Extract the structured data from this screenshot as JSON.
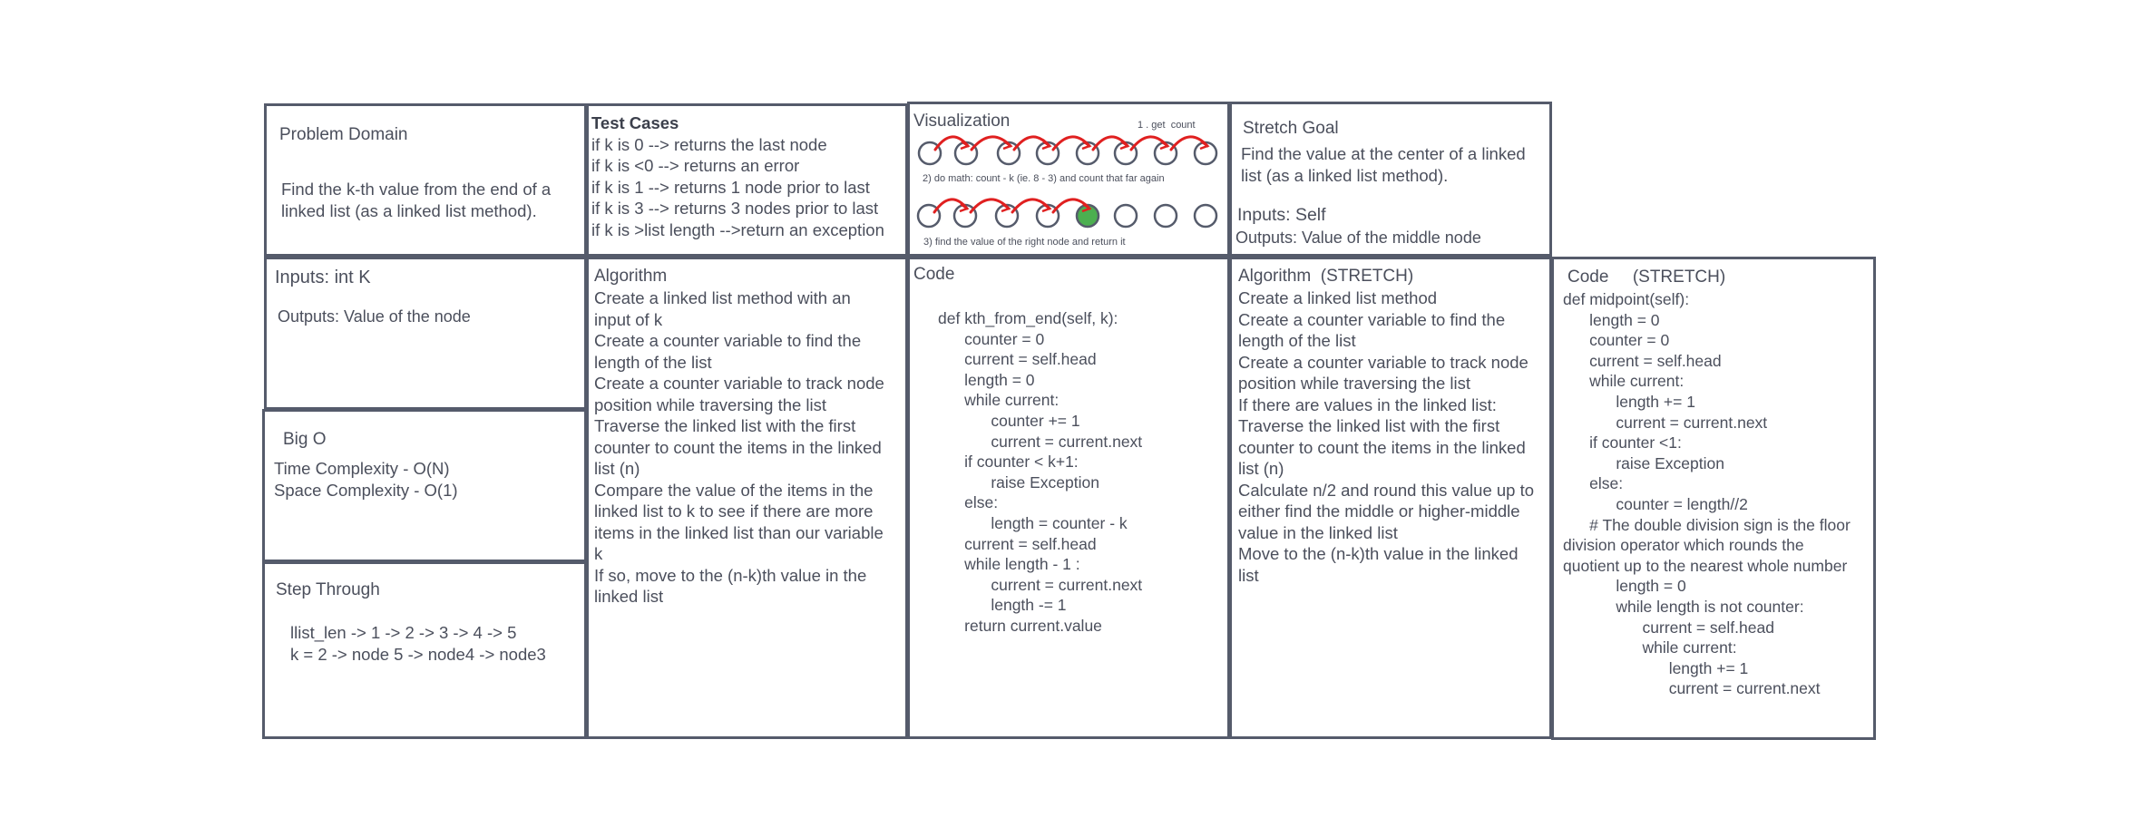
{
  "problem_domain": {
    "title": "Problem Domain",
    "lines": [
      "Find the k-th value from the end of a",
      "linked list (as a linked list method)."
    ]
  },
  "test_cases": {
    "title": "Test Cases",
    "lines": [
      "if k is 0 --> returns the last node",
      "if k is <0 --> returns an error",
      "if k is 1 --> returns 1 node prior to last",
      "if k is 3 --> returns 3 nodes prior to last",
      "if k is >list length -->return an exception"
    ]
  },
  "visualization": {
    "title": "Visualization",
    "step1": "1 . get  count",
    "step2": "2) do math: count - k (ie. 8 - 3) and count that far again",
    "step3": "3) find the value of the right node and return it",
    "row1_nodes": 8,
    "row2_nodes": 8,
    "highlight_node": 5,
    "arrow_color": "#e02020",
    "highlight_color": "#4caf50"
  },
  "stretch_goal": {
    "title": "Stretch Goal",
    "lines": [
      "Find the value at the center of a linked",
      "list (as a linked list method)."
    ],
    "inputs": "Inputs: Self",
    "outputs": "Outputs: Value of the middle node"
  },
  "inputs": {
    "title": "Inputs: int K",
    "outputs": "Outputs: Value of the node"
  },
  "algorithm": {
    "title": "Algorithm",
    "lines": [
      "Create a linked list method with an",
      "input of k",
      "Create a counter variable to find the",
      "length of the list",
      "Create a counter variable to track node",
      "position while traversing the list",
      "Traverse the linked list with the first",
      "counter to count the items in the linked",
      "list (n)",
      "Compare the value of the items in the",
      "linked list to k to see if there are more",
      "items in the linked list than our variable",
      "k",
      "If so, move to the (n-k)th value in the",
      "linked list"
    ]
  },
  "code": {
    "title": "Code",
    "lines": [
      "def kth_from_end(self, k):",
      "      counter = 0",
      "      current = self.head",
      "      length = 0",
      "      while current:",
      "            counter += 1",
      "            current = current.next",
      "      if counter < k+1:",
      "            raise Exception",
      "      else:",
      "            length = counter - k",
      "      current = self.head",
      "      while length - 1 :",
      "            current = current.next",
      "            length -= 1",
      "      return current.value"
    ]
  },
  "algorithm_stretch": {
    "title": "Algorithm  (STRETCH)",
    "lines": [
      "Create a linked list method",
      "Create a counter variable to find the",
      "length of the list",
      "Create a counter variable to track node",
      "position while traversing the list",
      "If there are values in the linked list:",
      "Traverse the linked list with the first",
      "counter to count the items in the linked",
      "list (n)",
      "Calculate n/2 and round this value up to",
      "either find the middle or higher-middle",
      "value in the linked list",
      "Move to the (n-k)th value in the linked",
      "list"
    ]
  },
  "code_stretch": {
    "title": "Code     (STRETCH)",
    "lines": [
      "def midpoint(self):",
      "      length = 0",
      "      counter = 0",
      "      current = self.head",
      "      while current:",
      "            length += 1",
      "            current = current.next",
      "      if counter <1:",
      "            raise Exception",
      "      else:",
      "            counter = length//2",
      "      # The double division sign is the floor",
      "division operator which rounds the",
      "quotient up to the nearest whole number",
      "",
      "            length = 0",
      "            while length is not counter:",
      "                  current = self.head",
      "                  while current:",
      "                        length += 1",
      "                        current = current.next"
    ]
  },
  "big_o": {
    "title": "Big O",
    "time": "Time Complexity - O(N)",
    "space": "Space Complexity - O(1)"
  },
  "step_through": {
    "title": "Step Through",
    "line1": "llist_len -> 1 -> 2 -> 3 -> 4 -> 5",
    "line2": "k = 2 -> node 5 -> node4 -> node3"
  }
}
